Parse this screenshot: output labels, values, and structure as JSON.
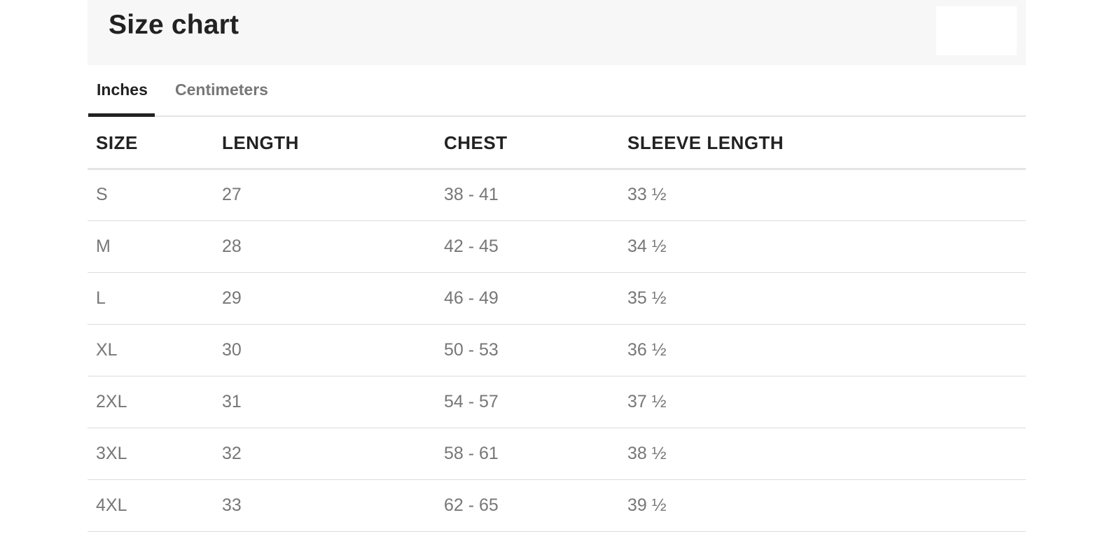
{
  "header": {
    "title": "Size chart"
  },
  "tabs": [
    {
      "label": "Inches",
      "active": true
    },
    {
      "label": "Centimeters",
      "active": false
    }
  ],
  "table": {
    "columns": [
      "SIZE",
      "LENGTH",
      "CHEST",
      "SLEEVE LENGTH"
    ],
    "rows": [
      [
        "S",
        "27",
        "38 - 41",
        "33 ½"
      ],
      [
        "M",
        "28",
        "42 - 45",
        "34 ½"
      ],
      [
        "L",
        "29",
        "46 - 49",
        "35 ½"
      ],
      [
        "XL",
        "30",
        "50 - 53",
        "36 ½"
      ],
      [
        "2XL",
        "31",
        "54 - 57",
        "37 ½"
      ],
      [
        "3XL",
        "32",
        "58 - 61",
        "38 ½"
      ],
      [
        "4XL",
        "33",
        "62 - 65",
        "39 ½"
      ]
    ]
  },
  "colors": {
    "header_bg": "#f7f7f7",
    "text_dark": "#222222",
    "text_muted": "#777777",
    "divider": "#dcdcdc"
  }
}
